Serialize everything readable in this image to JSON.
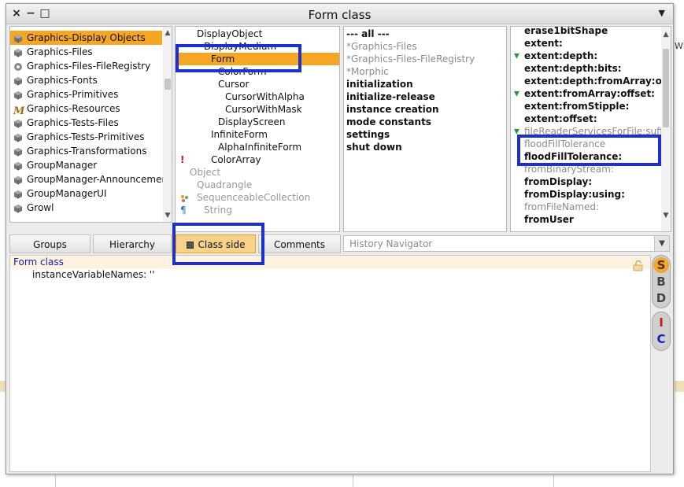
{
  "window": {
    "title": "Form class",
    "close_glyph": "×",
    "collapse_glyph": "−",
    "expand_glyph": "□",
    "menu_glyph": "▼"
  },
  "background": {
    "right_fragment": "Wh"
  },
  "packages": {
    "items": [
      {
        "label": "Graphics-Display Objects",
        "icon": "package-icon",
        "selected": true
      },
      {
        "label": "Graphics-Files",
        "icon": "package-icon"
      },
      {
        "label": "Graphics-Files-FileRegistry",
        "icon": "package-gear-icon"
      },
      {
        "label": "Graphics-Fonts",
        "icon": "package-icon"
      },
      {
        "label": "Graphics-Primitives",
        "icon": "package-icon"
      },
      {
        "label": "Graphics-Resources",
        "icon": "script-m-icon"
      },
      {
        "label": "Graphics-Tests-Files",
        "icon": "package-icon"
      },
      {
        "label": "Graphics-Tests-Primitives",
        "icon": "package-icon"
      },
      {
        "label": "Graphics-Transformations",
        "icon": "package-icon"
      },
      {
        "label": "GroupManager",
        "icon": "package-icon"
      },
      {
        "label": "GroupManager-Announcemen",
        "icon": "package-icon"
      },
      {
        "label": "GroupManagerUI",
        "icon": "package-icon"
      },
      {
        "label": "Growl",
        "icon": "package-icon"
      }
    ]
  },
  "classes": {
    "items": [
      {
        "label": "DisplayObject",
        "indent": 1
      },
      {
        "label": "DisplayMedium",
        "indent": 2
      },
      {
        "label": "Form",
        "indent": 3,
        "selected": true
      },
      {
        "label": "ColorForm",
        "indent": 4
      },
      {
        "label": "Cursor",
        "indent": 4
      },
      {
        "label": "CursorWithAlpha",
        "indent": 5
      },
      {
        "label": "CursorWithMask",
        "indent": 5
      },
      {
        "label": "DisplayScreen",
        "indent": 4
      },
      {
        "label": "InfiniteForm",
        "indent": 3
      },
      {
        "label": "AlphaInfiniteForm",
        "indent": 4
      },
      {
        "label": "ColorArray",
        "indent": 3,
        "icon": "warning-exclamation-icon"
      },
      {
        "label": "Object",
        "indent": 0,
        "gray": true
      },
      {
        "label": "Quadrangle",
        "indent": 1,
        "gray": true
      },
      {
        "label": "SequenceableCollection",
        "indent": 1,
        "gray": true,
        "icon": "collection-dots-icon"
      },
      {
        "label": "String",
        "indent": 2,
        "gray": true,
        "icon": "pilcrow-icon"
      }
    ]
  },
  "protocols": {
    "items": [
      {
        "label": "--- all ---",
        "style": "bold"
      },
      {
        "label": "*Graphics-Files",
        "style": "gray"
      },
      {
        "label": "*Graphics-Files-FileRegistry",
        "style": "gray"
      },
      {
        "label": "*Morphic",
        "style": "gray"
      },
      {
        "label": "initialization",
        "style": "bold"
      },
      {
        "label": "initialize-release",
        "style": "bold"
      },
      {
        "label": "instance creation",
        "style": "bold"
      },
      {
        "label": "mode constants",
        "style": "bold"
      },
      {
        "label": "settings",
        "style": "bold"
      },
      {
        "label": "shut down",
        "style": "bold"
      }
    ]
  },
  "methods": {
    "items": [
      {
        "label": "erase1bitShape"
      },
      {
        "label": "extent:"
      },
      {
        "label": "extent:depth:",
        "icon": "override-arrow-icon"
      },
      {
        "label": "extent:depth:bits:"
      },
      {
        "label": "extent:depth:fromArray:offset:"
      },
      {
        "label": "extent:fromArray:offset:",
        "icon": "override-arrow-icon"
      },
      {
        "label": "extent:fromStipple:"
      },
      {
        "label": "extent:offset:"
      },
      {
        "label": "fileReaderServicesForFile:suffix:",
        "gray": true,
        "icon": "override-arrow-icon"
      },
      {
        "label": "floodFillTolerance",
        "gray": true
      },
      {
        "label": "floodFillTolerance:"
      },
      {
        "label": "fromBinaryStream:",
        "gray": true
      },
      {
        "label": "fromDisplay:"
      },
      {
        "label": "fromDisplay:using:"
      },
      {
        "label": "fromFileNamed:",
        "gray": true
      },
      {
        "label": "fromUser"
      }
    ]
  },
  "tabs": {
    "groups": "Groups",
    "hierarchy": "Hierarchy",
    "class_side": "Class side",
    "comments": "Comments"
  },
  "history": {
    "placeholder": "History Navigator"
  },
  "editor": {
    "line1": "Form class",
    "line2": "instanceVariableNames: ''"
  },
  "side_buttons": {
    "s": "S",
    "b": "B",
    "d": "D",
    "i": "I",
    "c": "C"
  },
  "colors": {
    "selection": "#f5a623",
    "highlight_box": "#1d2fd0",
    "class_side_active": "#f7d28a"
  }
}
